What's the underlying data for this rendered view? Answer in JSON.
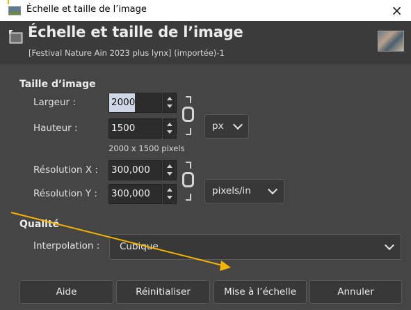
{
  "window": {
    "title": "Échelle et taille de l’image",
    "close_glyph": "×"
  },
  "header": {
    "title": "Échelle et taille de l’image",
    "subtitle": "[Festival Nature Ain 2023 plus lynx] (importée)-1"
  },
  "image_size": {
    "section_label": "Taille d’image",
    "width_label": "Largeur :",
    "width_value": "2000",
    "height_label": "Hauteur :",
    "height_value": "1500",
    "unit": "px",
    "summary": "2000 x 1500 pixels"
  },
  "resolution": {
    "x_label": "Résolution X :",
    "x_value": "300,000",
    "y_label": "Résolution Y :",
    "y_value": "300,000",
    "unit": "pixels/in"
  },
  "quality": {
    "section_label": "Qualité",
    "interpolation_label": "Interpolation :",
    "interpolation_value": "Cubique"
  },
  "buttons": {
    "help": "Aide",
    "reset": "Réinitialiser",
    "scale": "Mise à l’échelle",
    "cancel": "Annuler"
  },
  "colors": {
    "dialog_bg": "#454545",
    "header_bg": "#3b3b3b",
    "annotation": "#f5b400"
  },
  "icons": [
    "gimp-scale-icon",
    "chain-link-icon",
    "chevron-down-icon",
    "close-icon",
    "image-thumbnail"
  ]
}
